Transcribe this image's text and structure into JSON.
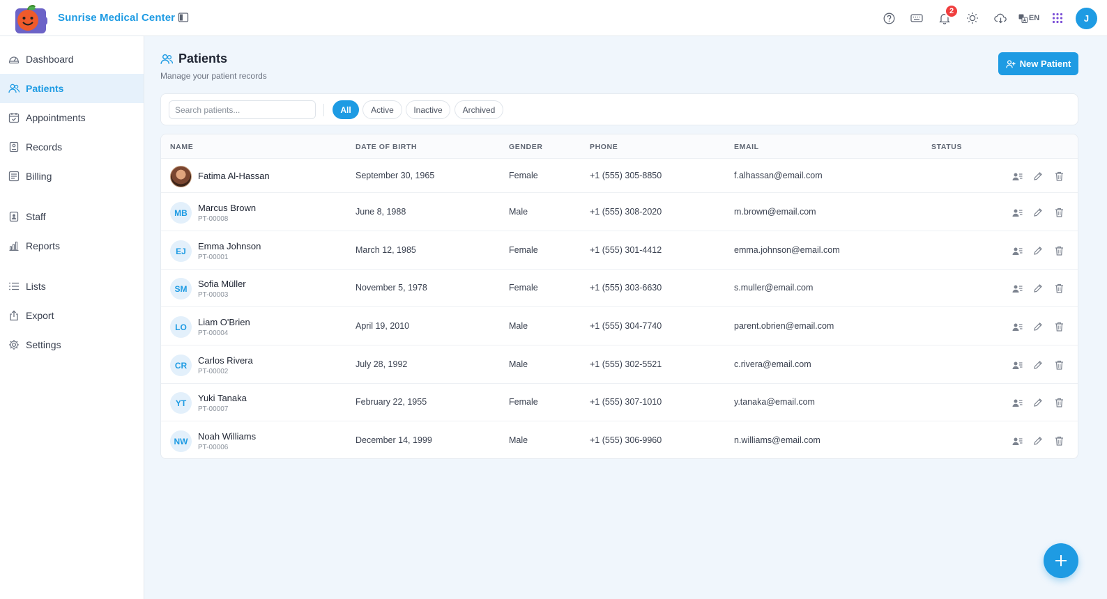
{
  "app": {
    "brand": "Sunrise Medical Center"
  },
  "header": {
    "notification_count": "2",
    "language": "EN",
    "user_initial": "J"
  },
  "sidebar": {
    "items": [
      {
        "label": "Dashboard",
        "icon": "dashboard-icon"
      },
      {
        "label": "Patients",
        "icon": "users-icon",
        "active": true
      },
      {
        "label": "Appointments",
        "icon": "calendar-icon"
      },
      {
        "label": "Records",
        "icon": "file-icon"
      },
      {
        "label": "Billing",
        "icon": "invoice-icon"
      },
      {
        "label": "Staff",
        "icon": "badge-icon"
      },
      {
        "label": "Reports",
        "icon": "bar-chart-icon"
      },
      {
        "label": "Lists",
        "icon": "list-icon"
      },
      {
        "label": "Export",
        "icon": "export-icon"
      },
      {
        "label": "Settings",
        "icon": "gear-icon"
      }
    ]
  },
  "page": {
    "title": "Patients",
    "subtitle": "Manage your patient records",
    "new_button": "New Patient"
  },
  "filters": {
    "search_placeholder": "Search patients...",
    "chips": [
      "All",
      "Active",
      "Inactive",
      "Archived"
    ],
    "selected": "All"
  },
  "table": {
    "columns": [
      "NAME",
      "DATE OF BIRTH",
      "GENDER",
      "PHONE",
      "EMAIL",
      "STATUS"
    ],
    "rows": [
      {
        "initials": "",
        "name": "Fatima Al-Hassan",
        "id": "",
        "dob": "September 30, 1965",
        "gender": "Female",
        "phone": "+1 (555) 305-8850",
        "email": "f.alhassan@email.com"
      },
      {
        "initials": "MB",
        "name": "Marcus Brown",
        "id": "PT-00008",
        "dob": "June 8, 1988",
        "gender": "Male",
        "phone": "+1 (555) 308-2020",
        "email": "m.brown@email.com"
      },
      {
        "initials": "EJ",
        "name": "Emma Johnson",
        "id": "PT-00001",
        "dob": "March 12, 1985",
        "gender": "Female",
        "phone": "+1 (555) 301-4412",
        "email": "emma.johnson@email.com"
      },
      {
        "initials": "SM",
        "name": "Sofia Müller",
        "id": "PT-00003",
        "dob": "November 5, 1978",
        "gender": "Female",
        "phone": "+1 (555) 303-6630",
        "email": "s.muller@email.com"
      },
      {
        "initials": "LO",
        "name": "Liam O'Brien",
        "id": "PT-00004",
        "dob": "April 19, 2010",
        "gender": "Male",
        "phone": "+1 (555) 304-7740",
        "email": "parent.obrien@email.com"
      },
      {
        "initials": "CR",
        "name": "Carlos Rivera",
        "id": "PT-00002",
        "dob": "July 28, 1992",
        "gender": "Male",
        "phone": "+1 (555) 302-5521",
        "email": "c.rivera@email.com"
      },
      {
        "initials": "YT",
        "name": "Yuki Tanaka",
        "id": "PT-00007",
        "dob": "February 22, 1955",
        "gender": "Female",
        "phone": "+1 (555) 307-1010",
        "email": "y.tanaka@email.com"
      },
      {
        "initials": "NW",
        "name": "Noah Williams",
        "id": "PT-00006",
        "dob": "December 14, 1999",
        "gender": "Male",
        "phone": "+1 (555) 306-9960",
        "email": "n.williams@email.com"
      }
    ]
  },
  "colors": {
    "accent": "#1e9be3",
    "badge": "#f03e3e"
  }
}
